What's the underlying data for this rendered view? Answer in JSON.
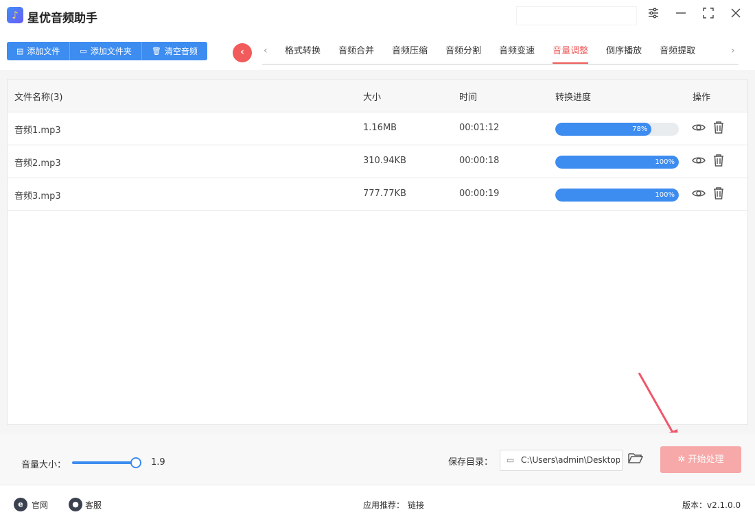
{
  "app": {
    "title": "星优音频助手",
    "logo_icon": "music-note-icon"
  },
  "toolbar": {
    "buttons": [
      {
        "label": "添加文件",
        "icon": "file-icon"
      },
      {
        "label": "添加文件夹",
        "icon": "folder-icon"
      },
      {
        "label": "清空音频",
        "icon": "trash-icon"
      }
    ]
  },
  "tabs": {
    "items": [
      "格式转换",
      "音频合并",
      "音频压缩",
      "音频分割",
      "音频变速",
      "音量调整",
      "倒序播放",
      "音频提取"
    ],
    "active": "音量调整"
  },
  "table": {
    "headers": {
      "name": "文件名称(3)",
      "size": "大小",
      "time": "时间",
      "progress": "转换进度",
      "ops": "操作"
    },
    "rows": [
      {
        "name": "音频1.mp3",
        "size": "1.16MB",
        "time": "00:01:12",
        "progress": 0.78,
        "progress_label": "78%"
      },
      {
        "name": "音频2.mp3",
        "size": "310.94KB",
        "time": "00:00:18",
        "progress": 1.0,
        "progress_label": "100%"
      },
      {
        "name": "音频3.mp3",
        "size": "777.77KB",
        "time": "00:00:19",
        "progress": 1.0,
        "progress_label": "100%"
      }
    ]
  },
  "settings": {
    "volume_label": "音量大小：",
    "volume_value": "1.9",
    "save_label": "保存目录：",
    "save_path": "C:\\Users\\admin\\Desktop",
    "start_label": "开始处理"
  },
  "footer": {
    "website": "官网",
    "service": "客服",
    "recommend": "应用推荐：",
    "link": "链接",
    "version": "版本：v2.1.0.0"
  },
  "colors": {
    "accent": "#3d8cf0",
    "active_tab": "#ef5b5b",
    "start_button": "#f7a8a8"
  }
}
